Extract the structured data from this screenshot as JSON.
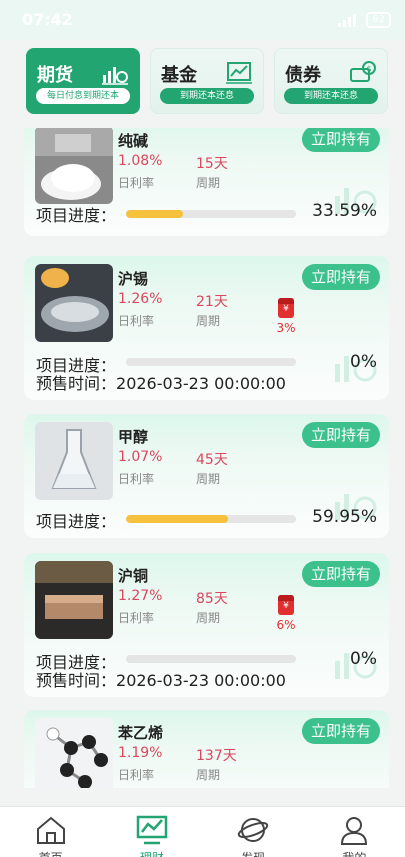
{
  "status_bar": {
    "time": "07:42",
    "battery": "62"
  },
  "categories": [
    {
      "name": "期货",
      "sub": "每日付息到期还本",
      "icon": "chart-bars-clock-icon",
      "active": true
    },
    {
      "name": "基金",
      "sub": "到期还本还息",
      "icon": "fund-chart-icon",
      "active": false
    },
    {
      "name": "债券",
      "sub": "到期还本还息",
      "icon": "bond-money-icon",
      "active": false
    }
  ],
  "labels": {
    "daily_rate": "日利率",
    "period": "周期",
    "progress": "项目进度：",
    "presale": "预售时间：",
    "hold": "立即持有"
  },
  "products": [
    {
      "name": "纯碱",
      "rate": "1.08%",
      "period": "15天",
      "progress_text": "33.59%",
      "progress": 33.59,
      "image": "soda-ash-photo"
    },
    {
      "name": "沪锡",
      "rate": "1.26%",
      "period": "21天",
      "bonus": "3%",
      "progress_text": "0%",
      "progress": 0,
      "presale_time": "2026-03-23 00:00:00",
      "image": "tin-photo"
    },
    {
      "name": "甲醇",
      "rate": "1.07%",
      "period": "45天",
      "progress_text": "59.95%",
      "progress": 59.95,
      "image": "methanol-flask-photo"
    },
    {
      "name": "沪铜",
      "rate": "1.27%",
      "period": "85天",
      "bonus": "6%",
      "progress_text": "0%",
      "progress": 0,
      "presale_time": "2026-03-23 00:00:00",
      "image": "copper-photo"
    },
    {
      "name": "苯乙烯",
      "rate": "1.19%",
      "period": "137天",
      "image": "styrene-molecule-photo"
    }
  ],
  "bottom_nav": [
    {
      "label": "首页",
      "icon": "home-icon",
      "active": false
    },
    {
      "label": "理财",
      "icon": "finance-chart-icon",
      "active": true
    },
    {
      "label": "发现",
      "icon": "discover-planet-icon",
      "active": false
    },
    {
      "label": "我的",
      "icon": "profile-icon",
      "active": false
    }
  ],
  "colors": {
    "accent": "#22a571",
    "button": "#3cc18d",
    "rate": "#d9485f",
    "progress": "#f6c23e",
    "bonus": "#e12f2f"
  }
}
